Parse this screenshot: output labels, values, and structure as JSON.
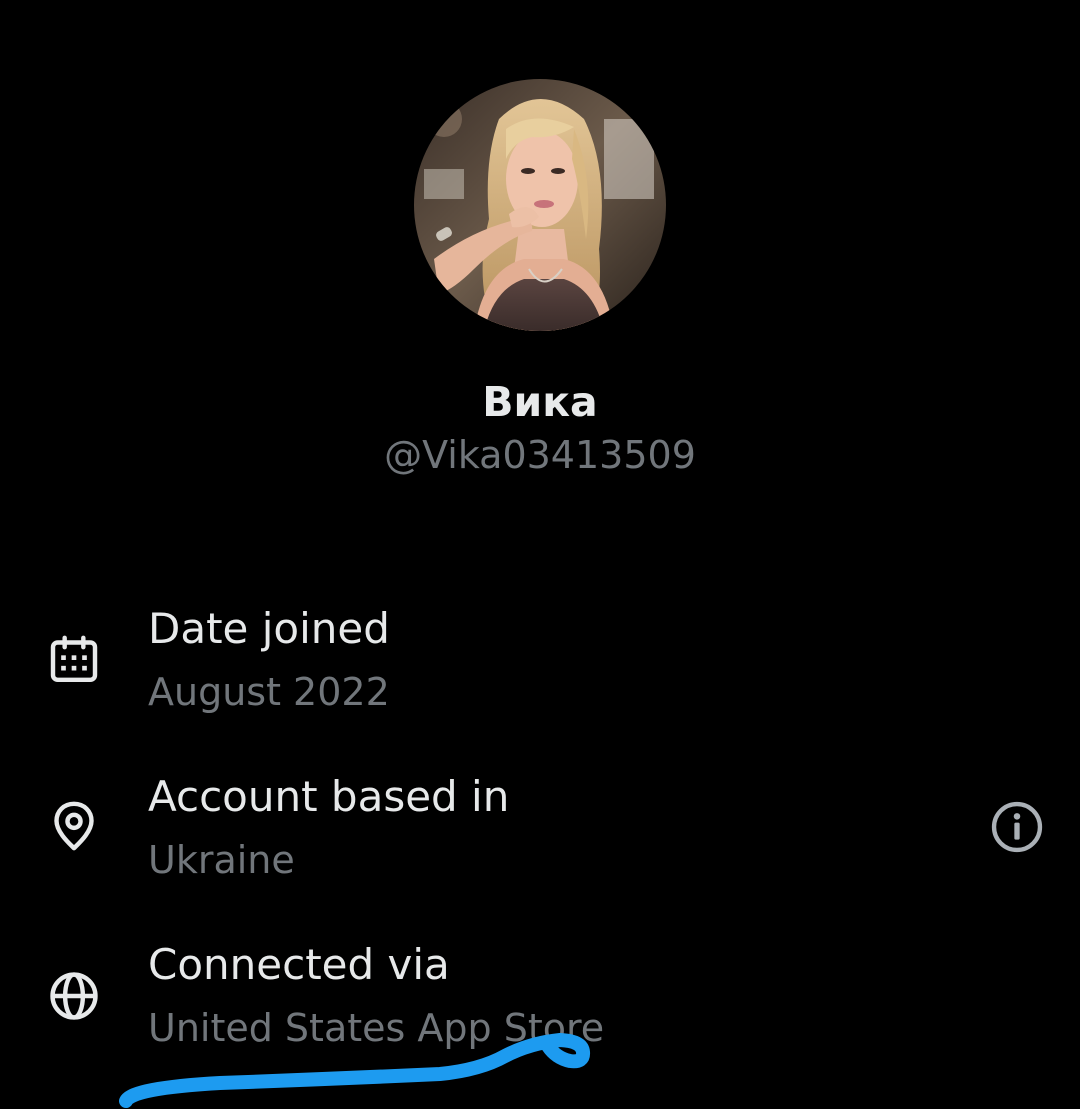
{
  "profile": {
    "display_name": "Вика",
    "handle": "@Vika03413509"
  },
  "details": {
    "date_joined": {
      "title": "Date joined",
      "value": "August 2022",
      "icon": "calendar-icon"
    },
    "account_based_in": {
      "title": "Account based in",
      "value": "Ukraine",
      "icon": "location-pin-icon",
      "info_icon": "info-icon"
    },
    "connected_via": {
      "title": "Connected via",
      "value": "United States App Store",
      "icon": "globe-icon"
    }
  },
  "colors": {
    "background": "#000000",
    "primary_text": "#e7e9ea",
    "secondary_text": "#71767b",
    "annotation_stroke": "#1d9bf0"
  }
}
